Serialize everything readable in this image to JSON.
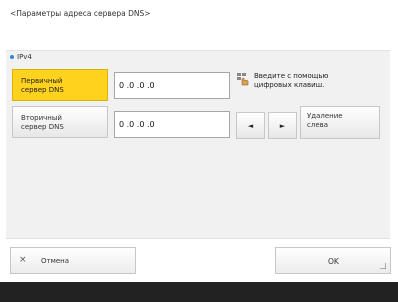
{
  "title": "<Параметры адреса сервера DNS>",
  "section": {
    "label": "IPv4"
  },
  "primary": {
    "label_line1": "Первичный",
    "label_line2": "сервер DNS",
    "value": "0 .0 .0 .0"
  },
  "secondary": {
    "label_line1": "Вторичный",
    "label_line2": "сервер DNS",
    "value": "0 .0 .0 .0"
  },
  "hint": {
    "line1": "Введите с помощью",
    "line2": "цифровых клавиш."
  },
  "controls": {
    "left_arrow": "◄",
    "right_arrow": "►",
    "delete_line1": "Удаление",
    "delete_line2": "слева"
  },
  "footer": {
    "cancel_icon": "×",
    "cancel_label": "Отмена",
    "ok_label": "OK"
  },
  "colors": {
    "active_label": "#ffd21e",
    "accent_dot": "#2f86d6",
    "bottom_bar": "#222222"
  }
}
